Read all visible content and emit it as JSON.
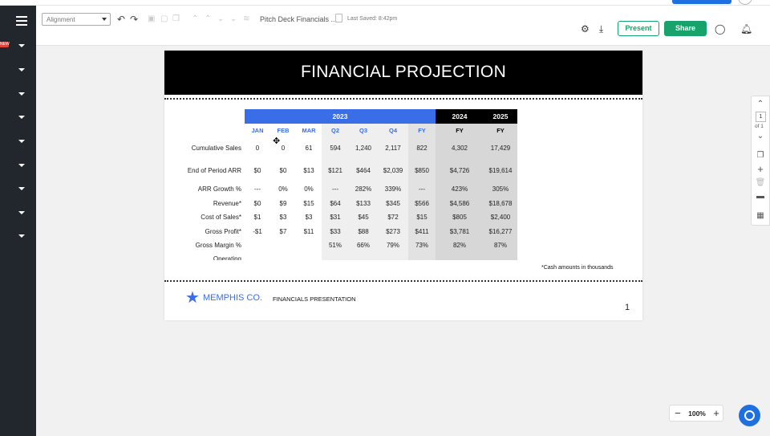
{
  "toolbar": {
    "alignment_select": "Alignment",
    "doc_title": "Pitch Deck Financials ...",
    "last_saved": "Last Saved: 8:42pm",
    "present_label": "Present",
    "share_label": "Share"
  },
  "sidebar": {
    "new_badge": "NEW"
  },
  "slide": {
    "title": "FINANCIAL PROJECTION",
    "table": {
      "year_2023": "2023",
      "year_2024": "2024",
      "year_2025": "2025",
      "subheaders": [
        "JAN",
        "FEB",
        "MAR",
        "Q2",
        "Q3",
        "Q4",
        "FY",
        "FY",
        "FY"
      ],
      "rows": [
        {
          "label": "Cumulative Sales",
          "values": [
            "0",
            "0",
            "61",
            "594",
            "1,240",
            "2,117",
            "822",
            "4,302",
            "17,429"
          ]
        },
        {
          "label": "End of Period ARR",
          "values": [
            "$0",
            "$0",
            "$13",
            "$121",
            "$464",
            "$2,039",
            "$850",
            "$4,726",
            "$19,614"
          ]
        },
        {
          "label": "ARR Growth %",
          "values": [
            "---",
            "0%",
            "0%",
            "---",
            "282%",
            "339%",
            "---",
            "423%",
            "305%"
          ]
        },
        {
          "label": "Revenue*",
          "values": [
            "$0",
            "$9",
            "$15",
            "$64",
            "$133",
            "$345",
            "$566",
            "$4,586",
            "$18,678"
          ]
        },
        {
          "label": "Cost of Sales*",
          "values": [
            "$1",
            "$3",
            "$3",
            "$31",
            "$45",
            "$72",
            "$15",
            "$805",
            "$2,400"
          ]
        },
        {
          "label": "Gross Profit*",
          "values": [
            "-$1",
            "$7",
            "$11",
            "$33",
            "$88",
            "$273",
            "$411",
            "$3,781",
            "$16,277"
          ]
        },
        {
          "label": "Gross Margin %",
          "values": [
            "",
            "",
            "",
            "51%",
            "66%",
            "79%",
            "73%",
            "82%",
            "87%"
          ]
        },
        {
          "label": "Operating",
          "values": [
            "",
            "",
            "",
            "",
            "",
            "",
            "",
            "",
            ""
          ]
        }
      ]
    },
    "cash_note": "*Cash amounts in thousands",
    "brand": "MEMPHIS CO.",
    "footer_text": "FINANCIALS PRESENTATION",
    "page_number": "1"
  },
  "right_panel": {
    "page_current": "1",
    "page_of": "of 1"
  },
  "zoom": {
    "minus": "−",
    "value": "100%",
    "plus": "+"
  },
  "colors": {
    "accent_blue": "#3a6ee8",
    "share_green": "#17a36b",
    "sidebar_bg": "#22272e"
  }
}
